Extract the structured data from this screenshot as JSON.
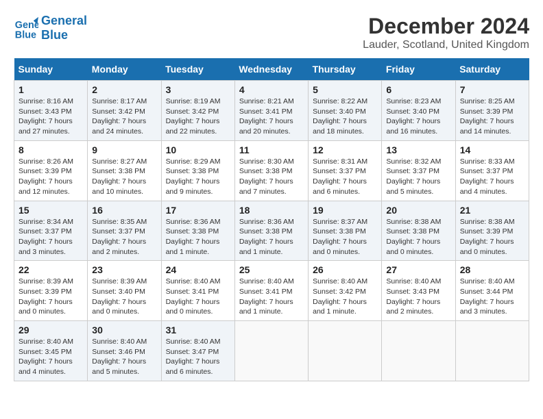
{
  "logo": {
    "line1": "General",
    "line2": "Blue"
  },
  "title": "December 2024",
  "location": "Lauder, Scotland, United Kingdom",
  "days_of_week": [
    "Sunday",
    "Monday",
    "Tuesday",
    "Wednesday",
    "Thursday",
    "Friday",
    "Saturday"
  ],
  "weeks": [
    [
      {
        "day": 1,
        "info": "Sunrise: 8:16 AM\nSunset: 3:43 PM\nDaylight: 7 hours and 27 minutes."
      },
      {
        "day": 2,
        "info": "Sunrise: 8:17 AM\nSunset: 3:42 PM\nDaylight: 7 hours and 24 minutes."
      },
      {
        "day": 3,
        "info": "Sunrise: 8:19 AM\nSunset: 3:42 PM\nDaylight: 7 hours and 22 minutes."
      },
      {
        "day": 4,
        "info": "Sunrise: 8:21 AM\nSunset: 3:41 PM\nDaylight: 7 hours and 20 minutes."
      },
      {
        "day": 5,
        "info": "Sunrise: 8:22 AM\nSunset: 3:40 PM\nDaylight: 7 hours and 18 minutes."
      },
      {
        "day": 6,
        "info": "Sunrise: 8:23 AM\nSunset: 3:40 PM\nDaylight: 7 hours and 16 minutes."
      },
      {
        "day": 7,
        "info": "Sunrise: 8:25 AM\nSunset: 3:39 PM\nDaylight: 7 hours and 14 minutes."
      }
    ],
    [
      {
        "day": 8,
        "info": "Sunrise: 8:26 AM\nSunset: 3:39 PM\nDaylight: 7 hours and 12 minutes."
      },
      {
        "day": 9,
        "info": "Sunrise: 8:27 AM\nSunset: 3:38 PM\nDaylight: 7 hours and 10 minutes."
      },
      {
        "day": 10,
        "info": "Sunrise: 8:29 AM\nSunset: 3:38 PM\nDaylight: 7 hours and 9 minutes."
      },
      {
        "day": 11,
        "info": "Sunrise: 8:30 AM\nSunset: 3:38 PM\nDaylight: 7 hours and 7 minutes."
      },
      {
        "day": 12,
        "info": "Sunrise: 8:31 AM\nSunset: 3:37 PM\nDaylight: 7 hours and 6 minutes."
      },
      {
        "day": 13,
        "info": "Sunrise: 8:32 AM\nSunset: 3:37 PM\nDaylight: 7 hours and 5 minutes."
      },
      {
        "day": 14,
        "info": "Sunrise: 8:33 AM\nSunset: 3:37 PM\nDaylight: 7 hours and 4 minutes."
      }
    ],
    [
      {
        "day": 15,
        "info": "Sunrise: 8:34 AM\nSunset: 3:37 PM\nDaylight: 7 hours and 3 minutes."
      },
      {
        "day": 16,
        "info": "Sunrise: 8:35 AM\nSunset: 3:37 PM\nDaylight: 7 hours and 2 minutes."
      },
      {
        "day": 17,
        "info": "Sunrise: 8:36 AM\nSunset: 3:38 PM\nDaylight: 7 hours and 1 minute."
      },
      {
        "day": 18,
        "info": "Sunrise: 8:36 AM\nSunset: 3:38 PM\nDaylight: 7 hours and 1 minute."
      },
      {
        "day": 19,
        "info": "Sunrise: 8:37 AM\nSunset: 3:38 PM\nDaylight: 7 hours and 0 minutes."
      },
      {
        "day": 20,
        "info": "Sunrise: 8:38 AM\nSunset: 3:38 PM\nDaylight: 7 hours and 0 minutes."
      },
      {
        "day": 21,
        "info": "Sunrise: 8:38 AM\nSunset: 3:39 PM\nDaylight: 7 hours and 0 minutes."
      }
    ],
    [
      {
        "day": 22,
        "info": "Sunrise: 8:39 AM\nSunset: 3:39 PM\nDaylight: 7 hours and 0 minutes."
      },
      {
        "day": 23,
        "info": "Sunrise: 8:39 AM\nSunset: 3:40 PM\nDaylight: 7 hours and 0 minutes."
      },
      {
        "day": 24,
        "info": "Sunrise: 8:40 AM\nSunset: 3:41 PM\nDaylight: 7 hours and 0 minutes."
      },
      {
        "day": 25,
        "info": "Sunrise: 8:40 AM\nSunset: 3:41 PM\nDaylight: 7 hours and 1 minute."
      },
      {
        "day": 26,
        "info": "Sunrise: 8:40 AM\nSunset: 3:42 PM\nDaylight: 7 hours and 1 minute."
      },
      {
        "day": 27,
        "info": "Sunrise: 8:40 AM\nSunset: 3:43 PM\nDaylight: 7 hours and 2 minutes."
      },
      {
        "day": 28,
        "info": "Sunrise: 8:40 AM\nSunset: 3:44 PM\nDaylight: 7 hours and 3 minutes."
      }
    ],
    [
      {
        "day": 29,
        "info": "Sunrise: 8:40 AM\nSunset: 3:45 PM\nDaylight: 7 hours and 4 minutes."
      },
      {
        "day": 30,
        "info": "Sunrise: 8:40 AM\nSunset: 3:46 PM\nDaylight: 7 hours and 5 minutes."
      },
      {
        "day": 31,
        "info": "Sunrise: 8:40 AM\nSunset: 3:47 PM\nDaylight: 7 hours and 6 minutes."
      },
      null,
      null,
      null,
      null
    ]
  ]
}
